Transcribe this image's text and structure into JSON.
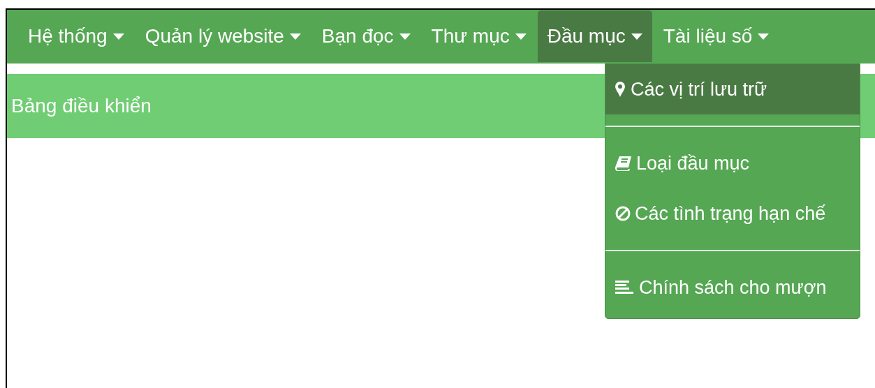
{
  "navbar": {
    "items": [
      {
        "label": "Hệ thống",
        "selected": false
      },
      {
        "label": "Quản lý website",
        "selected": false
      },
      {
        "label": "Bạn đọc",
        "selected": false
      },
      {
        "label": "Thư mục",
        "selected": false
      },
      {
        "label": "Đầu mục",
        "selected": true
      },
      {
        "label": "Tài liệu số",
        "selected": false
      }
    ]
  },
  "dropdown": {
    "items": [
      {
        "kind": "item",
        "label": "Các vị trí lưu trữ",
        "selected": true
      },
      {
        "kind": "divider"
      },
      {
        "kind": "item",
        "label": "Loại đầu mục",
        "selected": false
      },
      {
        "kind": "item",
        "label": "Các tình trạng hạn chế",
        "selected": false
      },
      {
        "kind": "divider"
      },
      {
        "kind": "item",
        "label": "Chính sách cho mượn",
        "selected": false
      }
    ]
  },
  "header": {
    "title": "Bảng điều khiển"
  }
}
